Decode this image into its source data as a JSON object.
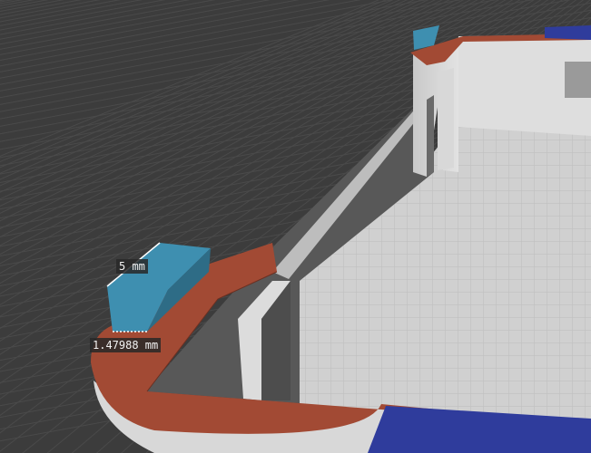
{
  "viewport": {
    "colors": {
      "background": "#3c3c3c",
      "grid_line": "#4a4a4a",
      "model_top_surface": "#a24a34",
      "model_wall": "#d6d6d6",
      "model_floor": "#cdcdcd",
      "model_inner_shadow": "#585858",
      "selected_tab": "#3e8fb0",
      "blue_face": "#2f3c9c"
    }
  },
  "measurements": {
    "width_label": "5 mm",
    "depth_label": "1.47988 mm"
  }
}
